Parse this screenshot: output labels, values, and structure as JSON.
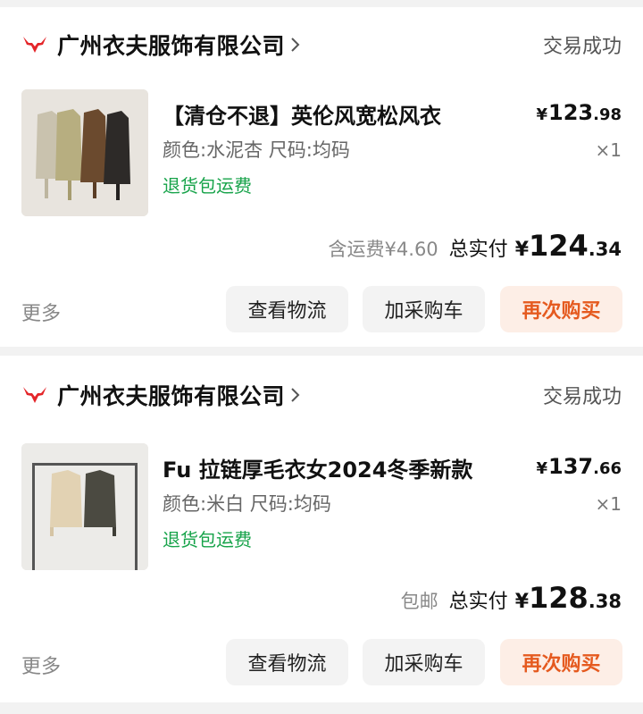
{
  "orders": [
    {
      "shop_name": "广州衣夫服饰有限公司",
      "status": "交易成功",
      "title": "【清仓不退】英伦风宽松风衣",
      "spec": "颜色:水泥杏 尺码:均码",
      "return_tag": "退货包运费",
      "price_symbol": "¥",
      "price_int": "123",
      "price_dec": ".98",
      "qty": "×1",
      "shipping_note": "含运费¥4.60",
      "total_label": "总实付",
      "total_symbol": "¥",
      "total_int": "124",
      "total_dec": ".34",
      "more": "更多",
      "btn_logistics": "查看物流",
      "btn_cart": "加采购车",
      "btn_rebuy": "再次购买"
    },
    {
      "shop_name": "广州衣夫服饰有限公司",
      "status": "交易成功",
      "title": "Fu 拉链厚毛衣女2024冬季新款",
      "spec": "颜色:米白 尺码:均码",
      "return_tag": "退货包运费",
      "price_symbol": "¥",
      "price_int": "137",
      "price_dec": ".66",
      "qty": "×1",
      "shipping_note": "包邮",
      "total_label": "总实付",
      "total_symbol": "¥",
      "total_int": "128",
      "total_dec": ".38",
      "more": "更多",
      "btn_logistics": "查看物流",
      "btn_cart": "加采购车",
      "btn_rebuy": "再次购买"
    }
  ],
  "colors": {
    "accent_red": "#e4262a",
    "green_tag": "#17a34a",
    "rebuy_text": "#e55a1f",
    "rebuy_bg": "#fdeee6"
  },
  "icons": [
    "shop-logo-icon",
    "chevron-right-icon"
  ]
}
